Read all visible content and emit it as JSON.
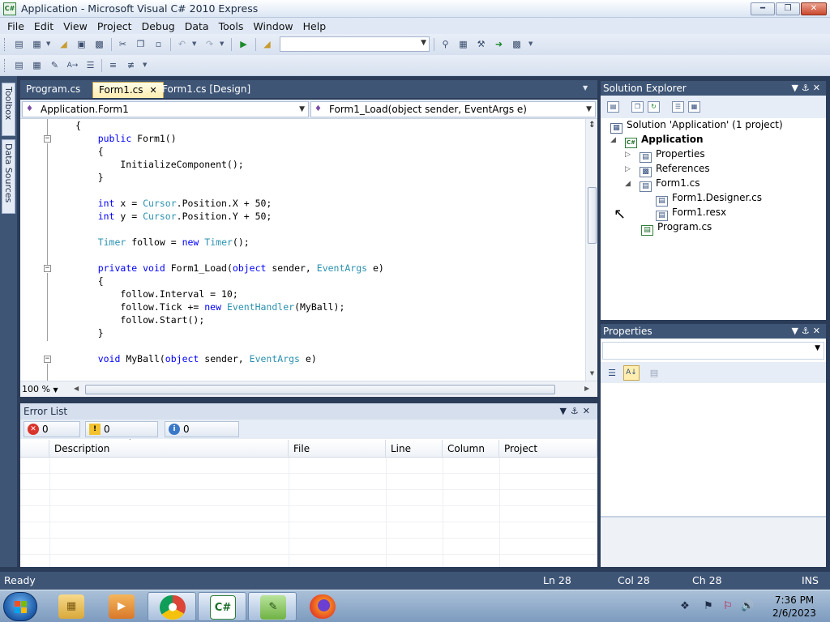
{
  "window": {
    "title": "Application - Microsoft Visual C# 2010 Express",
    "icon_text": "C#"
  },
  "menu": [
    "File",
    "Edit",
    "View",
    "Project",
    "Debug",
    "Data",
    "Tools",
    "Window",
    "Help"
  ],
  "side_tabs": [
    "Toolbox",
    "Data Sources"
  ],
  "editor": {
    "tabs": [
      {
        "label": "Program.cs"
      },
      {
        "label": "Form1.cs",
        "active": true
      },
      {
        "label": "Form1.cs [Design]"
      }
    ],
    "class_combo": "Application.Form1",
    "member_combo": "Form1_Load(object sender, EventArgs e)",
    "zoom": "100 %",
    "code_lines": [
      [
        {
          "t": "{"
        }
      ],
      [
        {
          "t": "    "
        },
        {
          "t": "public",
          "c": "kw"
        },
        {
          "t": " Form1()"
        }
      ],
      [
        {
          "t": "    {"
        }
      ],
      [
        {
          "t": "        InitializeComponent();"
        }
      ],
      [
        {
          "t": "    }"
        }
      ],
      [
        {
          "t": ""
        }
      ],
      [
        {
          "t": "    "
        },
        {
          "t": "int",
          "c": "kw"
        },
        {
          "t": " x = "
        },
        {
          "t": "Cursor",
          "c": "ty"
        },
        {
          "t": ".Position.X + 50;"
        }
      ],
      [
        {
          "t": "    "
        },
        {
          "t": "int",
          "c": "kw"
        },
        {
          "t": " y = "
        },
        {
          "t": "Cursor",
          "c": "ty"
        },
        {
          "t": ".Position.Y + 50;"
        }
      ],
      [
        {
          "t": ""
        }
      ],
      [
        {
          "t": "    "
        },
        {
          "t": "Timer",
          "c": "ty"
        },
        {
          "t": " follow = "
        },
        {
          "t": "new",
          "c": "kw"
        },
        {
          "t": " "
        },
        {
          "t": "Timer",
          "c": "ty"
        },
        {
          "t": "();"
        }
      ],
      [
        {
          "t": ""
        }
      ],
      [
        {
          "t": "    "
        },
        {
          "t": "private",
          "c": "kw"
        },
        {
          "t": " "
        },
        {
          "t": "void",
          "c": "kw"
        },
        {
          "t": " Form1_Load("
        },
        {
          "t": "object",
          "c": "kw"
        },
        {
          "t": " sender, "
        },
        {
          "t": "EventArgs",
          "c": "ty"
        },
        {
          "t": " e)"
        }
      ],
      [
        {
          "t": "    {"
        }
      ],
      [
        {
          "t": "        follow.Interval = 10;"
        }
      ],
      [
        {
          "t": "        follow.Tick += "
        },
        {
          "t": "new",
          "c": "kw"
        },
        {
          "t": " "
        },
        {
          "t": "EventHandler",
          "c": "ty"
        },
        {
          "t": "(MyBall);"
        }
      ],
      [
        {
          "t": "        follow.Start();"
        }
      ],
      [
        {
          "t": "    }"
        }
      ],
      [
        {
          "t": ""
        }
      ],
      [
        {
          "t": "    "
        },
        {
          "t": "void",
          "c": "kw"
        },
        {
          "t": " MyBall("
        },
        {
          "t": "object",
          "c": "kw"
        },
        {
          "t": " sender, "
        },
        {
          "t": "EventArgs",
          "c": "ty"
        },
        {
          "t": " e)"
        }
      ],
      [
        {
          "t": ""
        }
      ],
      [
        {
          "t": "    {"
        }
      ]
    ]
  },
  "error_list": {
    "title": "Error List",
    "errors": "0 Errors",
    "warnings": "0 Warnings",
    "messages": "0 Messages",
    "columns": [
      "Description",
      "File",
      "Line",
      "Column",
      "Project"
    ]
  },
  "solution_explorer": {
    "title": "Solution Explorer",
    "solution": "Solution 'Application' (1 project)",
    "project": "Application",
    "nodes": [
      "Properties",
      "References",
      "Form1.cs",
      "Form1.Designer.cs",
      "Form1.resx",
      "Program.cs"
    ]
  },
  "properties": {
    "title": "Properties"
  },
  "status": {
    "state": "Ready",
    "ln": "Ln 28",
    "col": "Col 28",
    "ch": "Ch 28",
    "mode": "INS"
  },
  "taskbar": {
    "time": "7:36 PM",
    "date": "2/6/2023"
  },
  "colors": {
    "keyword": "#0000ff",
    "type": "#2b91af",
    "chrome": "#3e5576"
  }
}
